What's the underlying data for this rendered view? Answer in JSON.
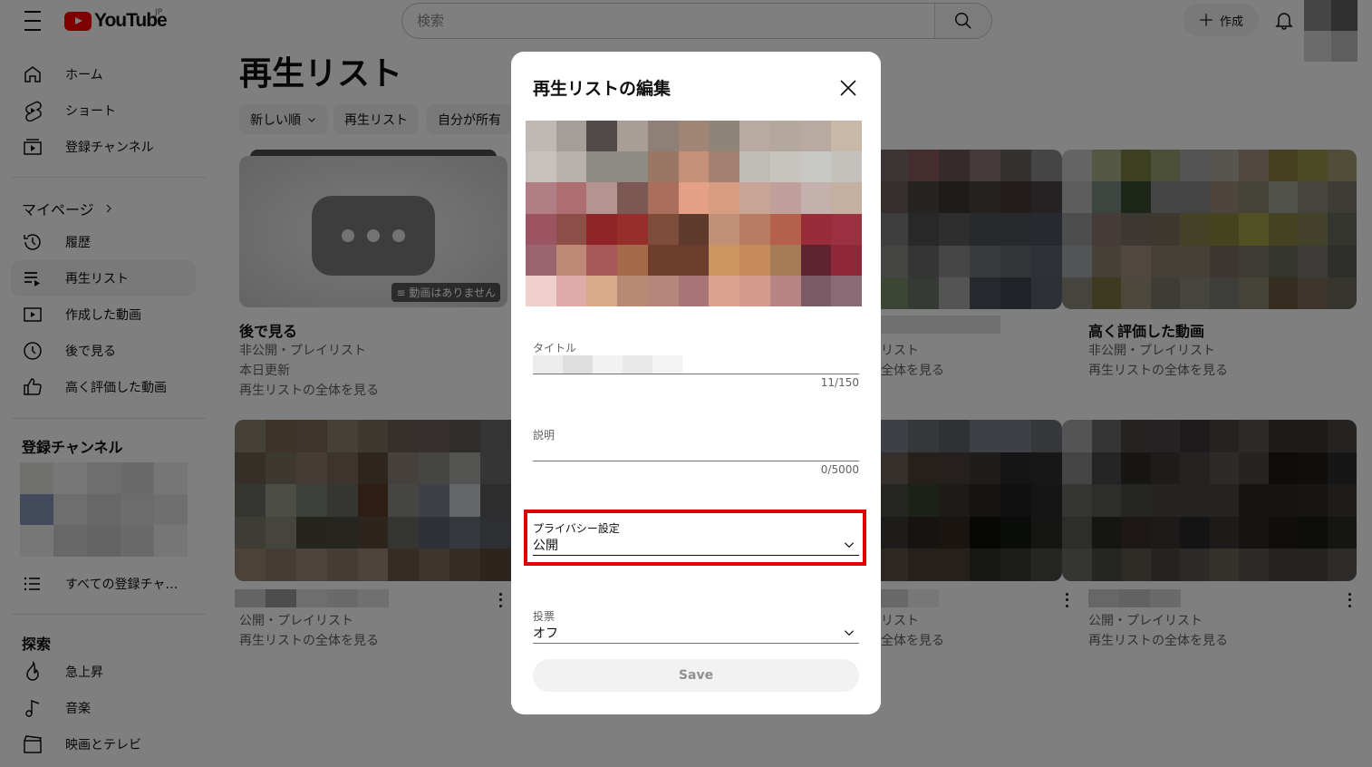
{
  "header": {
    "logo_text": "YouTube",
    "region": "JP",
    "search_placeholder": "検索",
    "create_label": "作成"
  },
  "sidebar": {
    "primary": [
      {
        "label": "ホーム",
        "icon": "home-icon"
      },
      {
        "label": "ショート",
        "icon": "shorts-icon"
      },
      {
        "label": "登録チャンネル",
        "icon": "subscriptions-icon"
      }
    ],
    "mypage_heading": "マイページ",
    "mypage": [
      {
        "label": "履歴",
        "icon": "history-icon"
      },
      {
        "label": "再生リスト",
        "icon": "playlists-icon",
        "active": true
      },
      {
        "label": "作成した動画",
        "icon": "your-videos-icon"
      },
      {
        "label": "後で見る",
        "icon": "watch-later-icon"
      },
      {
        "label": "高く評価した動画",
        "icon": "like-icon"
      }
    ],
    "subscriptions_heading": "登録チャンネル",
    "all_subscriptions_label": "すべての登録チャ…",
    "explore_heading": "探索",
    "explore": [
      {
        "label": "急上昇",
        "icon": "trending-icon"
      },
      {
        "label": "音楽",
        "icon": "music-icon"
      },
      {
        "label": "映画とテレビ",
        "icon": "movies-icon"
      }
    ]
  },
  "main": {
    "title": "再生リスト",
    "chips": [
      "新しい順",
      "再生リスト",
      "自分が所有"
    ],
    "cards": [
      {
        "title": "後で見る",
        "meta1": "非公開・プレイリスト",
        "meta2": "本日更新",
        "link": "再生リストの全体を見る",
        "badge": "動画はありません"
      },
      {
        "title": "",
        "meta1": "リスト",
        "link": "全体を見る"
      },
      {
        "title": "高く評価した動画",
        "meta1": "非公開・プレイリスト",
        "link": "再生リストの全体を見る"
      },
      {
        "title": "",
        "meta1": "公開・プレイリスト",
        "link": "再生リストの全体を見る"
      },
      {
        "title": "",
        "meta1": "リスト",
        "link": "全体を見る"
      },
      {
        "title": "",
        "meta1": "公開・プレイリスト",
        "link": "再生リストの全体を見る"
      }
    ]
  },
  "dialog": {
    "title": "再生リストの編集",
    "title_field_label": "タイトル",
    "title_counter": "11/150",
    "description_label": "説明",
    "description_counter": "0/5000",
    "privacy_label": "プライバシー設定",
    "privacy_value": "公開",
    "voting_label": "投票",
    "voting_value": "オフ",
    "save_label": "Save"
  },
  "colors": {
    "brand_red": "#ff0000",
    "highlight_red": "#e50000",
    "overlay": "rgba(0,0,0,0.5)"
  }
}
